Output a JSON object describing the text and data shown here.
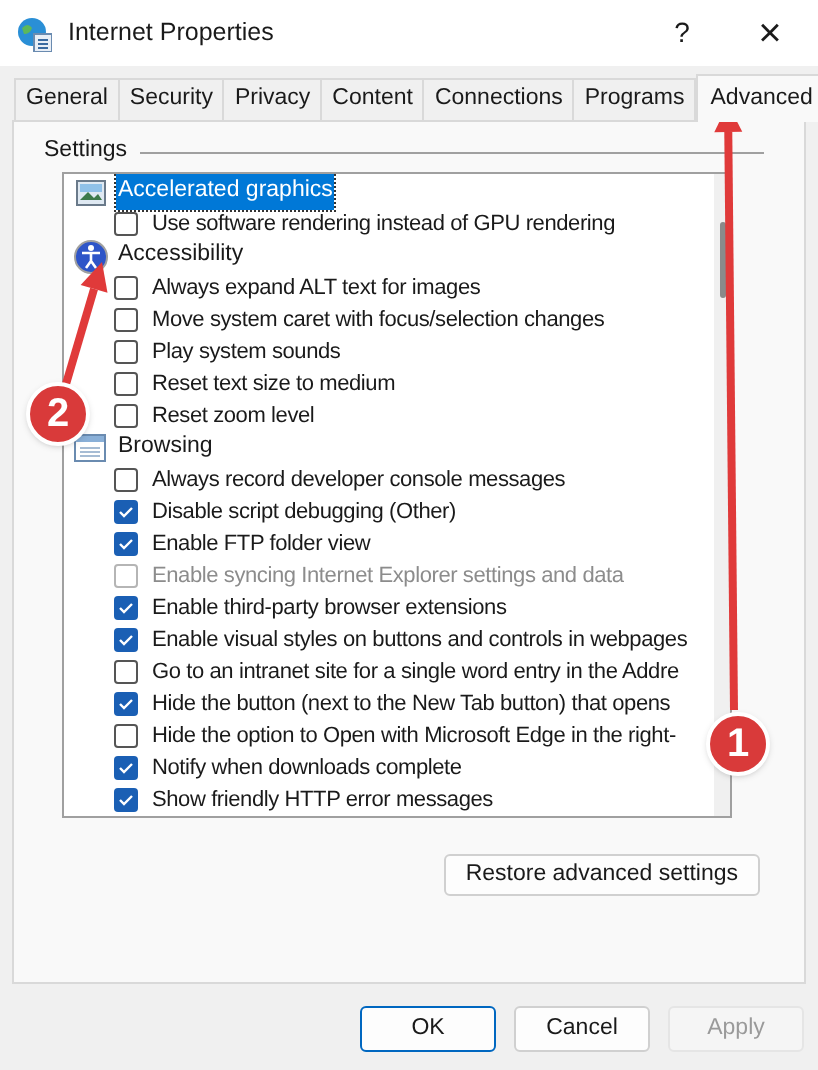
{
  "window": {
    "title": "Internet Properties",
    "help": "?",
    "close": "×"
  },
  "tabs": [
    {
      "label": "General",
      "selected": false
    },
    {
      "label": "Security",
      "selected": false
    },
    {
      "label": "Privacy",
      "selected": false
    },
    {
      "label": "Content",
      "selected": false
    },
    {
      "label": "Connections",
      "selected": false
    },
    {
      "label": "Programs",
      "selected": false
    },
    {
      "label": "Advanced",
      "selected": true
    }
  ],
  "group_label": "Settings",
  "settings": [
    {
      "kind": "category",
      "label": "Accelerated graphics",
      "selected": true
    },
    {
      "kind": "option",
      "label": "Use software rendering instead of GPU rendering",
      "checked": false,
      "disabled": false
    },
    {
      "kind": "category",
      "label": "Accessibility",
      "selected": false
    },
    {
      "kind": "option",
      "label": "Always expand ALT text for images",
      "checked": false,
      "disabled": false
    },
    {
      "kind": "option",
      "label": "Move system caret with focus/selection changes",
      "checked": false,
      "disabled": false
    },
    {
      "kind": "option",
      "label": "Play system sounds",
      "checked": false,
      "disabled": false
    },
    {
      "kind": "option",
      "label": "Reset text size to medium",
      "checked": false,
      "disabled": false
    },
    {
      "kind": "option",
      "label": "Reset zoom level",
      "checked": false,
      "disabled": false
    },
    {
      "kind": "category",
      "label": "Browsing",
      "selected": false
    },
    {
      "kind": "option",
      "label": "Always record developer console messages",
      "checked": false,
      "disabled": false
    },
    {
      "kind": "option",
      "label": "Disable script debugging (Other)",
      "checked": true,
      "disabled": false
    },
    {
      "kind": "option",
      "label": "Enable FTP folder view",
      "checked": true,
      "disabled": false
    },
    {
      "kind": "option",
      "label": "Enable syncing Internet Explorer settings and data",
      "checked": false,
      "disabled": true
    },
    {
      "kind": "option",
      "label": "Enable third-party browser extensions",
      "checked": true,
      "disabled": false
    },
    {
      "kind": "option",
      "label": "Enable visual styles on buttons and controls in webpages",
      "checked": true,
      "disabled": false
    },
    {
      "kind": "option",
      "label": "Go to an intranet site for a single word entry in the Addre",
      "checked": false,
      "disabled": false
    },
    {
      "kind": "option",
      "label": "Hide the button (next to the New Tab button) that opens",
      "checked": true,
      "disabled": false
    },
    {
      "kind": "option",
      "label": "Hide the option to Open with Microsoft Edge in the right-",
      "checked": false,
      "disabled": false
    },
    {
      "kind": "option",
      "label": "Notify when downloads complete",
      "checked": true,
      "disabled": false
    },
    {
      "kind": "option",
      "label": "Show friendly HTTP error messages",
      "checked": true,
      "disabled": false
    }
  ],
  "restore_button": "Restore advanced settings",
  "buttons": [
    {
      "label": "OK",
      "disabled": false
    },
    {
      "label": "Cancel",
      "disabled": false
    },
    {
      "label": "Apply",
      "disabled": true
    }
  ],
  "annotations": [
    {
      "label": "1"
    },
    {
      "label": "2"
    }
  ]
}
